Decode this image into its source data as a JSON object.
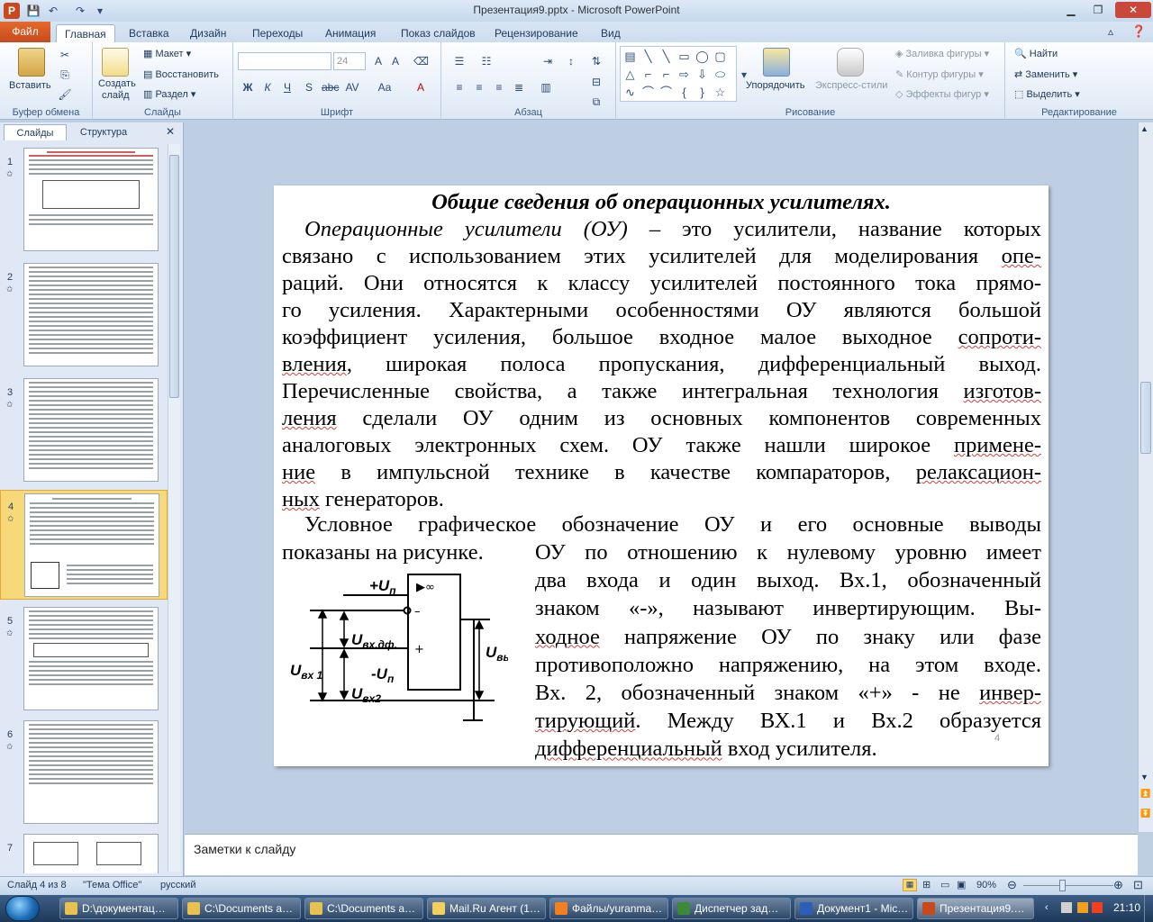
{
  "window": {
    "title": "Презентация9.pptx - Microsoft PowerPoint"
  },
  "ribbon_tabs": [
    "Файл",
    "Главная",
    "Вставка",
    "Дизайн",
    "Переходы",
    "Анимация",
    "Показ слайдов",
    "Рецензирование",
    "Вид"
  ],
  "ribbon": {
    "clipboard": {
      "label": "Буфер обмена",
      "paste": "Вставить"
    },
    "slides": {
      "label": "Слайды",
      "new_slide": "Создать",
      "new_slide2": "слайд",
      "layout": "Макет",
      "reset": "Восстановить",
      "section": "Раздел"
    },
    "font": {
      "label": "Шрифт",
      "size": "24"
    },
    "paragraph": {
      "label": "Абзац"
    },
    "drawing": {
      "label": "Рисование",
      "arrange": "Упорядочить",
      "quick_styles": "Экспресс-стили",
      "fill": "Заливка фигуры",
      "outline": "Контур фигуры",
      "effects": "Эффекты фигур"
    },
    "editing": {
      "label": "Редактирование",
      "find": "Найти",
      "replace": "Заменить",
      "select": "Выделить"
    }
  },
  "left_panel": {
    "tab_slides": "Слайды",
    "tab_outline": "Структура",
    "slides": [
      "1",
      "2",
      "3",
      "4",
      "5",
      "6",
      "7"
    ],
    "selected": "4"
  },
  "slide": {
    "title": "Общие сведения об операционных усилителях.",
    "lines": [
      [
        "",
        "Операционные усилители (ОУ)",
        " – это усилители, название которых"
      ],
      [
        "связано с использованием этих усилителей для моделирования ",
        "опе-",
        ""
      ],
      [
        "раций. Они относятся к классу усилителей постоянного тока прямо-",
        "",
        ""
      ],
      [
        "го усиления. Характерными особенностями ОУ являются большой",
        "",
        ""
      ],
      [
        "коэффициент усиления, большое входное малое выходное ",
        "сопроти-",
        ""
      ],
      [
        "",
        "вления",
        ", широкая полоса пропускания, дифференциальный выход."
      ],
      [
        "Перечисленные свойства, а также интегральная технология ",
        "изготов-",
        ""
      ],
      [
        "",
        "ления",
        " сделали ОУ одним из основных компонентов современных"
      ],
      [
        "аналоговых электронных схем. ОУ также нашли широкое ",
        "примене-",
        ""
      ],
      [
        "",
        "ние",
        " в импульсной технике в качестве компараторов, ",
        "релаксацион-"
      ],
      [
        "",
        "ных",
        " генераторов."
      ]
    ],
    "p2_line1": "Условное графическое обозначение ОУ и его основные выводы",
    "p2_line2": "показаны на рисунке.",
    "right_lines": [
      [
        "ОУ по отношению к нулевому уровню имеет",
        ""
      ],
      [
        "два входа и один выход. Вх.1, обозначенный",
        ""
      ],
      [
        "знаком «-», называют инвертирующим. Вы-",
        ""
      ],
      [
        "",
        "ходное",
        " напряжение ОУ по знаку или фазе"
      ],
      [
        "противоположно напряжению, на этом входе.",
        ""
      ],
      [
        "Вх. 2, обозначенный знаком «+» - не ",
        "инвер-"
      ],
      [
        "",
        "тирующий",
        ". Между ВХ.1 и Вх.2 образуется"
      ],
      [
        "",
        "дифференциальный",
        " вход усилителя."
      ]
    ],
    "page_number": "4",
    "circuit": {
      "vplus": "+U",
      "vplus_sub": "п",
      "vdiff": "U",
      "vdiff_sub": "вх.дф.",
      "vminus": "-U",
      "vminus_sub": "п",
      "vin1": "U",
      "vin1_sub": "вх 1",
      "vin2": "U",
      "vin2_sub": "вх2",
      "vout": "U",
      "vout_sub": "вых",
      "inf": "▶∞",
      "minus": "–",
      "plus": "+"
    }
  },
  "notes": {
    "placeholder": "Заметки к слайду"
  },
  "status": {
    "slide_info": "Слайд 4 из 8",
    "theme": "\"Тема Office\"",
    "language": "русский",
    "zoom": "90%"
  },
  "taskbar": {
    "items": [
      "D:\\документац…",
      "C:\\Documents a…",
      "C:\\Documents a…",
      "Mail.Ru Агент (1…",
      "Файлы/yuranma…",
      "Диспетчер зад…",
      "Документ1 - Mic…",
      "Презентация9.…"
    ],
    "clock": "21:10"
  },
  "colors": {
    "file_tab": "#d9561f",
    "selected_thumb": "#f6c744",
    "ribbon_bg": "#dde8f5"
  }
}
